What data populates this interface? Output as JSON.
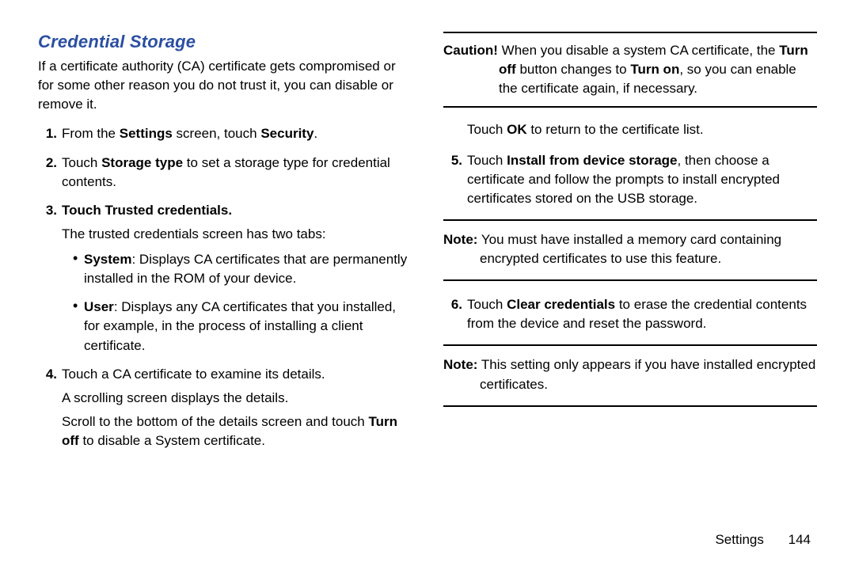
{
  "heading": "Credential Storage",
  "intro": "If a certificate authority (CA) certificate gets compromised or for some other reason you do not trust it, you can disable or remove it.",
  "left_steps": [
    {
      "num": "1.",
      "pre": "From the ",
      "bold1": "Settings",
      "mid": " screen, touch ",
      "bold2": "Security",
      "post": "."
    },
    {
      "num": "2.",
      "pre": "Touch ",
      "bold1": "Storage type",
      "post": " to set a storage type for credential contents."
    },
    {
      "num": "3.",
      "whole_bold_pre": "Touch ",
      "whole_bold": "Trusted credentials",
      "whole_bold_post": ".",
      "sub": "The trusted credentials screen has two tabs:",
      "bullets": [
        {
          "bold": "System",
          "text": ": Displays CA certificates that are permanently installed in the ROM of your device."
        },
        {
          "bold": "User",
          "text": ": Displays any CA certificates that you installed, for example, in the process of installing a client certificate."
        }
      ]
    },
    {
      "num": "4.",
      "line1": "Touch a CA certificate to examine its details.",
      "line2": "A scrolling screen displays the details.",
      "line3_pre": "Scroll to the bottom of the details screen and touch ",
      "line3_bold": "Turn off",
      "line3_post": " to disable a System certificate."
    }
  ],
  "caution": {
    "label": "Caution!",
    "text_pre": " When you disable a system CA certificate, the ",
    "bold1": "Turn off",
    "mid": " button changes to ",
    "bold2": "Turn on",
    "post": ", so you can enable the certificate again, if necessary."
  },
  "right_line": {
    "pre": "Touch ",
    "bold": "OK",
    "post": " to return to the certificate list."
  },
  "right_steps": [
    {
      "num": "5.",
      "pre": "Touch ",
      "bold": "Install from device storage",
      "post": ", then choose a certificate and follow the prompts to install encrypted certificates stored on the USB storage."
    }
  ],
  "note1": {
    "label": "Note:",
    "text": " You must have installed a memory card containing encrypted certificates to use this feature."
  },
  "right_steps2": [
    {
      "num": "6.",
      "pre": "Touch ",
      "bold": "Clear credentials",
      "post": " to erase the credential contents from the device and reset the password."
    }
  ],
  "note2": {
    "label": "Note:",
    "text": " This setting only appears if you have installed encrypted certificates."
  },
  "footer": {
    "section": "Settings",
    "page": "144"
  }
}
